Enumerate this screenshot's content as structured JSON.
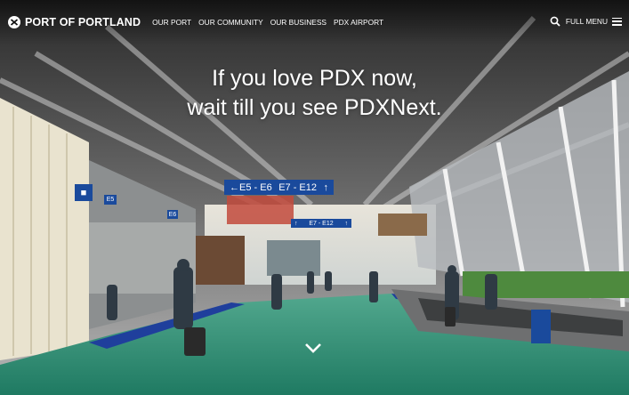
{
  "brand": {
    "name": "PORT OF PORTLAND",
    "logo_icon": "port-of-portland-logo-icon"
  },
  "nav": {
    "items": [
      {
        "label": "OUR PORT"
      },
      {
        "label": "OUR COMMUNITY"
      },
      {
        "label": "OUR BUSINESS"
      },
      {
        "label": "PDX AIRPORT"
      }
    ],
    "search_icon": "search-icon",
    "full_menu_label": "FULL MENU",
    "menu_icon": "hamburger-icon"
  },
  "hero": {
    "headline_line1": "If you love PDX now,",
    "headline_line2": "wait till you see PDXNext.",
    "scroll_icon": "chevron-down-icon"
  },
  "signs": {
    "gate_left": "←E5 - E6",
    "gate_right": "E7 - E12",
    "lower": "E7 - E12",
    "e5": "E5",
    "e6": "E6"
  },
  "colors": {
    "accent_blue": "#1a4a9c",
    "carpet": "#2b8f74",
    "text": "#ffffff"
  }
}
